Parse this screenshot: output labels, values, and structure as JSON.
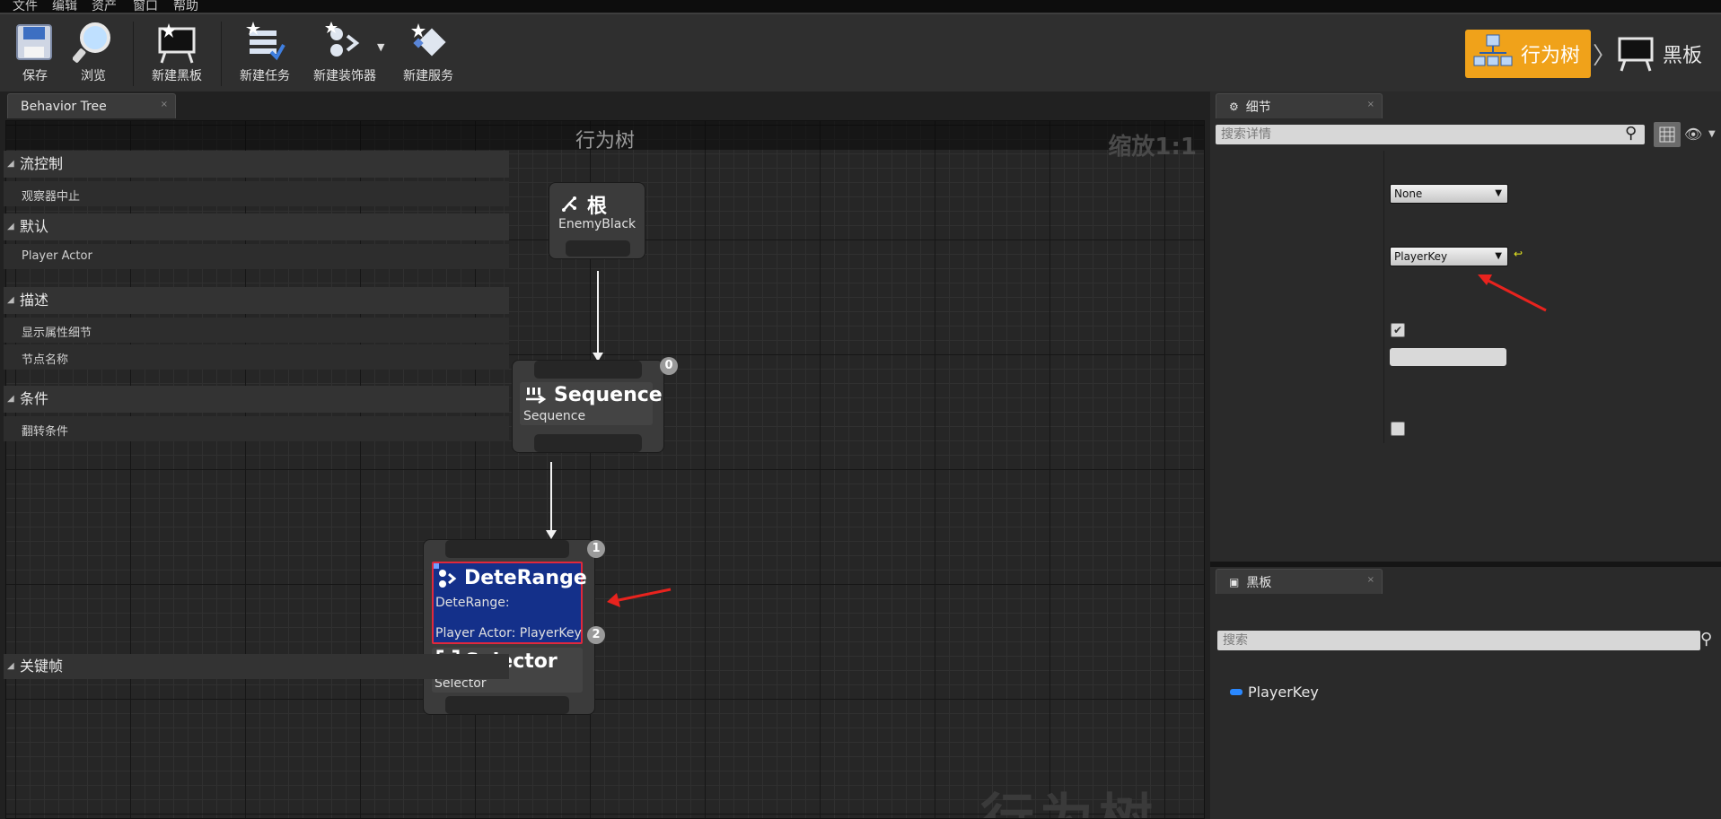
{
  "menu": [
    "文件",
    "编辑",
    "资产",
    "窗口",
    "帮助"
  ],
  "toolbar": {
    "save": "保存",
    "browse": "浏览",
    "new_blackboard": "新建黑板",
    "new_task": "新建任务",
    "new_decorator": "新建装饰器",
    "new_service": "新建服务"
  },
  "modes": {
    "behavior_tree": "行为树",
    "blackboard": "黑板"
  },
  "graph_tab": "Behavior Tree",
  "graph": {
    "title": "行为树",
    "zoom": "缩放1:1",
    "watermark": "行为树",
    "root": {
      "title": "根",
      "subtitle": "EnemyBlack"
    },
    "sequence": {
      "title": "Sequence",
      "subtitle": "Sequence",
      "index": "0"
    },
    "decorator": {
      "title": "DeteRange",
      "line1": "DeteRange:",
      "line2": "Player Actor: PlayerKey",
      "index_top": "1",
      "index_bottom": "2"
    },
    "selector": {
      "title": "Selector",
      "subtitle": "Selector"
    }
  },
  "details": {
    "tab": "细节",
    "search_placeholder": "搜索详情",
    "categories": {
      "flow": "流控制",
      "default": "默认",
      "description": "描述",
      "condition": "条件"
    },
    "props": {
      "observer_abort": {
        "label": "观察器中止",
        "value": "None"
      },
      "player_actor": {
        "label": "Player Actor",
        "value": "PlayerKey"
      },
      "show_details": {
        "label": "显示属性细节",
        "checked": true
      },
      "node_name": {
        "label": "节点名称",
        "value": ""
      },
      "invert": {
        "label": "翻转条件",
        "checked": false
      }
    }
  },
  "blackboard": {
    "tab": "黑板",
    "search_placeholder": "搜索",
    "category": "关键帧",
    "keys": [
      "PlayerKey"
    ]
  },
  "colors": {
    "accent": "#f0a21a",
    "decorator_fill": "#14308a",
    "selection": "#e0283c",
    "annotation_arrow": "#e8231e"
  }
}
